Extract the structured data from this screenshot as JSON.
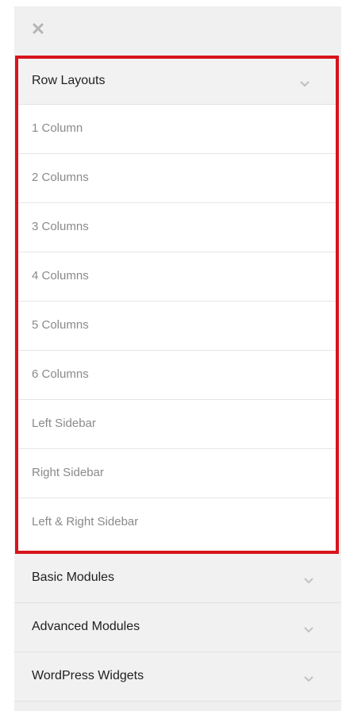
{
  "close_button": {
    "icon": "close-icon"
  },
  "row_layouts": {
    "title": "Row Layouts",
    "icon": "chevron-down-icon",
    "items": [
      {
        "label": "1 Column"
      },
      {
        "label": "2 Columns"
      },
      {
        "label": "3 Columns"
      },
      {
        "label": "4 Columns"
      },
      {
        "label": "5 Columns"
      },
      {
        "label": "6 Columns"
      },
      {
        "label": "Left Sidebar"
      },
      {
        "label": "Right Sidebar"
      },
      {
        "label": "Left & Right Sidebar"
      }
    ]
  },
  "sections": [
    {
      "label": "Basic Modules",
      "icon": "chevron-down-icon"
    },
    {
      "label": "Advanced Modules",
      "icon": "chevron-down-icon"
    },
    {
      "label": "WordPress Widgets",
      "icon": "chevron-down-icon"
    }
  ],
  "colors": {
    "highlight_border": "#d7141b",
    "panel_background": "#efefef",
    "item_text": "#8a8a8a",
    "header_text": "#222222"
  }
}
